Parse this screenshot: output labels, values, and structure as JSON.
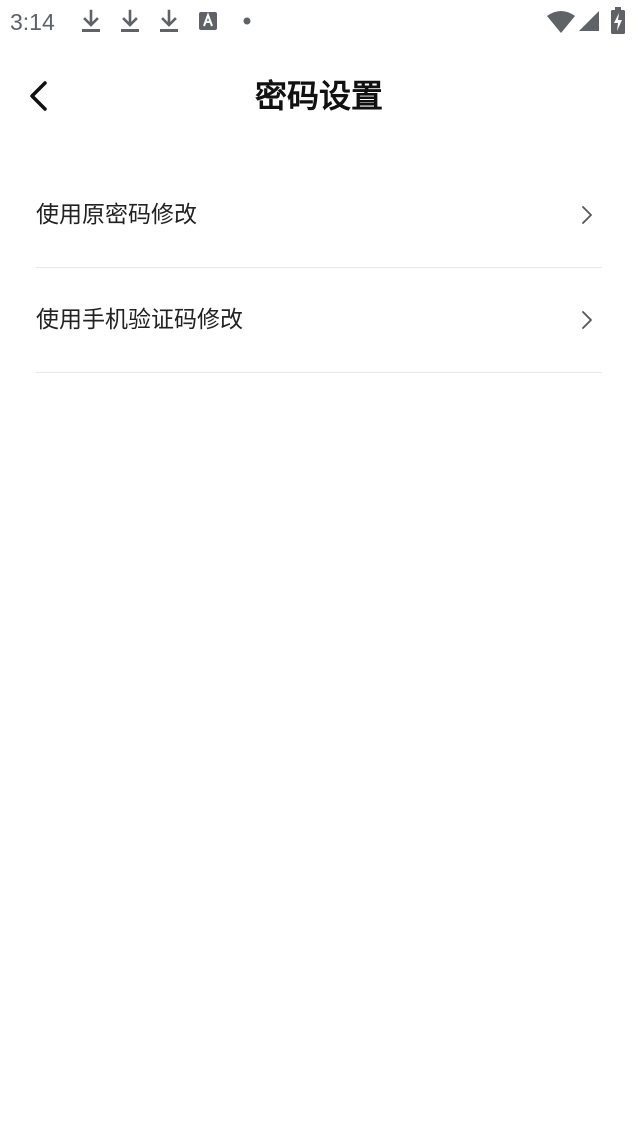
{
  "status_bar": {
    "time": "3:14",
    "icons": [
      "download-icon",
      "download-icon",
      "download-icon",
      "font-a-icon",
      "dot-icon",
      "wifi-icon",
      "signal-icon",
      "battery-charging-icon"
    ]
  },
  "header": {
    "title": "密码设置",
    "back_icon": "chevron-left-icon"
  },
  "menu": {
    "items": [
      {
        "label": "使用原密码修改",
        "icon": "chevron-right-icon"
      },
      {
        "label": "使用手机验证码修改",
        "icon": "chevron-right-icon"
      }
    ]
  },
  "colors": {
    "background": "#ffffff",
    "text_primary": "#111111",
    "text_item": "#222222",
    "divider": "#e8e8e8",
    "status_icon": "#5f6368"
  }
}
